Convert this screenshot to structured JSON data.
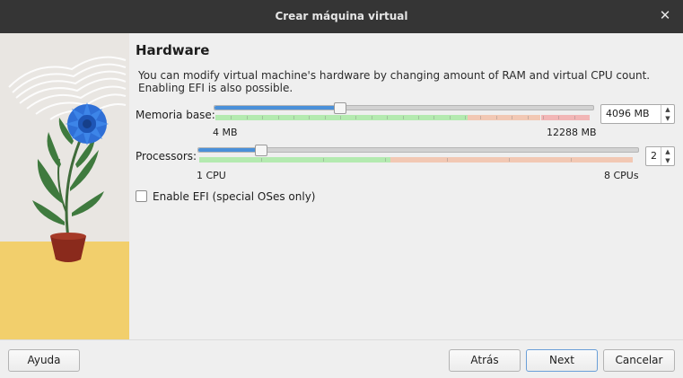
{
  "window": {
    "title": "Crear máquina virtual"
  },
  "page": {
    "title": "Hardware",
    "description_line1": "You can modify virtual machine's hardware by changing amount of RAM and virtual CPU count.",
    "description_line2": "Enabling EFI is also possible."
  },
  "memory": {
    "label": "Memoria base:",
    "value": "4096 MB",
    "min_label": "4 MB",
    "max_label": "12288 MB",
    "min_mb": 4,
    "max_mb": 12288,
    "current_mb": 4096
  },
  "processors": {
    "label": "Processors:",
    "value": "2",
    "min_label": "1 CPU",
    "max_label": "8 CPUs",
    "min": 1,
    "max": 8,
    "current": 2
  },
  "efi": {
    "label": "Enable EFI (special OSes only)",
    "checked": false
  },
  "buttons": {
    "help": "Ayuda",
    "back": "Atrás",
    "next": "Next",
    "cancel": "Cancelar"
  },
  "colors": {
    "accent": "#4a90d9",
    "scale_ok": "#b4eab0",
    "scale_warn": "#f2c8b4",
    "scale_danger": "#f2b6b6",
    "art_sand": "#f2cf6c"
  }
}
